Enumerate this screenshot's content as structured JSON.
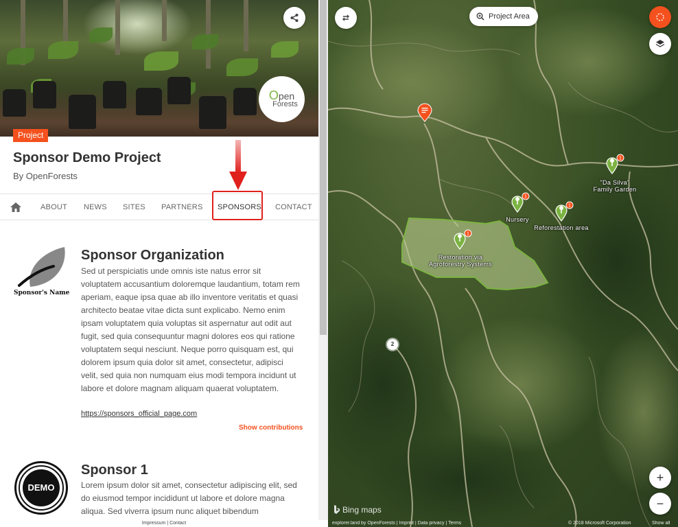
{
  "project": {
    "badge": "Project",
    "title": "Sponsor Demo Project",
    "byline": "By OpenForests",
    "logo_line1_letter": "O",
    "logo_line1_rest": "pen",
    "logo_line2": "Forests"
  },
  "nav": {
    "tabs": [
      "ABOUT",
      "NEWS",
      "SITES",
      "PARTNERS",
      "SPONSORS",
      "CONTACT"
    ],
    "active": "SPONSORS"
  },
  "sponsors": [
    {
      "logo_caption": "Sponsor's Name",
      "name": "Sponsor Organization",
      "description": "Sed ut perspiciatis unde omnis iste natus error sit voluptatem accusantium doloremque laudantium, totam rem aperiam, eaque ipsa quae ab illo inventore veritatis et quasi architecto beatae vitae dicta sunt explicabo. Nemo enim ipsam voluptatem quia voluptas sit aspernatur aut odit aut fugit, sed quia consequuntur magni dolores eos qui ratione voluptatem sequi nesciunt. Neque porro quisquam est, qui dolorem ipsum quia dolor sit amet, consectetur, adipisci velit, sed quia non numquam eius modi tempora incidunt ut labore et dolore magnam aliquam quaerat voluptatem.",
      "link": "https://sponsors_official_page.com",
      "contributions": "Show contributions"
    },
    {
      "logo_caption": "DEMO",
      "name": "Sponsor 1",
      "description": "Lorem ipsum dolor sit amet, consectetur adipiscing elit, sed do eiusmod tempor incididunt ut labore et dolore magna aliqua. Sed viverra ipsum nunc aliquet bibendum"
    }
  ],
  "footer": {
    "impressum": "Impressum",
    "separator": "|",
    "contact": "Contact"
  },
  "map": {
    "project_area_label": "Project Area",
    "markers": [
      {
        "label_line1": "\"Da Silva\"",
        "label_line2": "Family Garden",
        "count": "1"
      },
      {
        "label_line1": "Nursery",
        "count": "1"
      },
      {
        "label_line1": "Reforestation area",
        "count": "1"
      },
      {
        "label_line1": "Restoration via",
        "label_line2": "Agroforestry Systems",
        "count": "1"
      }
    ],
    "cluster_count": "2",
    "bing_label": "Bing maps",
    "footer_left": "explorer.land by OpenForests | Imprint | Data privacy | Terms",
    "footer_right": "© 2018 Microsoft Corporation",
    "show_all": "Show all",
    "zoom_in": "+",
    "zoom_out": "−"
  },
  "colors": {
    "accent": "#f4511e",
    "highlight": "#e0201c",
    "marker_green": "#7cb342",
    "polygon_fill": "#b7c98a"
  },
  "icons": [
    "share-icon",
    "home-icon",
    "swap-arrows-icon",
    "search-zoom-icon",
    "layers-icon",
    "loading-spinner-icon",
    "document-marker-icon",
    "tree-marker-icon"
  ]
}
